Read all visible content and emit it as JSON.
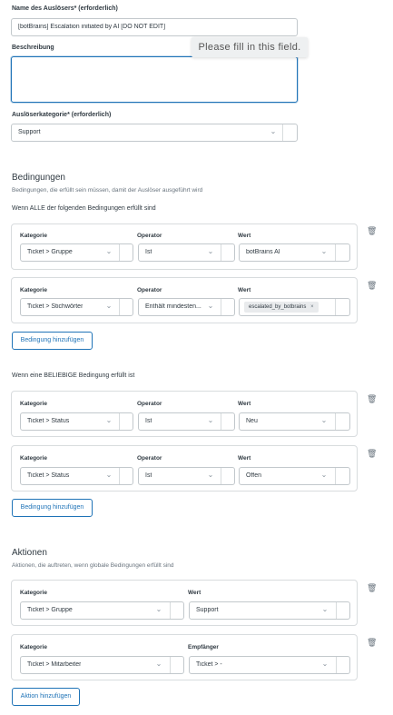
{
  "trigger_name": {
    "label": "Name des Auslösers* (erforderlich)",
    "value": "[botBrains] Escalation initiated by AI [DO NOT EDIT]"
  },
  "description": {
    "label": "Beschreibung",
    "value": "",
    "tooltip": "Please fill in this field."
  },
  "category": {
    "label": "Auslöserkategorie* (erforderlich)",
    "value": "Support"
  },
  "conditions": {
    "title": "Bedingungen",
    "subtitle": "Bedingungen, die erfüllt sein müssen, damit der Auslöser ausgeführt wird",
    "all_heading": "Wenn ALLE der folgenden Bedingungen erfüllt sind",
    "any_heading": "Wenn eine BELIEBIGE Bedingung erfüllt ist",
    "add_label": "Bedingung hinzufügen",
    "col_category": "Kategorie",
    "col_operator": "Operator",
    "col_value": "Wert",
    "all": [
      {
        "category": "Ticket > Gruppe",
        "operator": "Ist",
        "value": "botBrains AI"
      },
      {
        "category": "Ticket > Stichwörter",
        "operator": "Enthält mindesten...",
        "tag": "escalated_by_botbrains",
        "tag_remove": "×"
      }
    ],
    "any": [
      {
        "category": "Ticket > Status",
        "operator": "Ist",
        "value": "Neu"
      },
      {
        "category": "Ticket > Status",
        "operator": "Ist",
        "value": "Offen"
      }
    ]
  },
  "actions": {
    "title": "Aktionen",
    "subtitle": "Aktionen, die auftreten, wenn globale Bedingungen erfüllt sind",
    "add_label": "Aktion hinzufügen",
    "items": [
      {
        "category_label": "Kategorie",
        "category": "Ticket > Gruppe",
        "value_label": "Wert",
        "value": "Support"
      },
      {
        "category_label": "Kategorie",
        "category": "Ticket > Mitarbeiter",
        "value_label": "Empfänger",
        "value": "Ticket > -"
      }
    ]
  },
  "icons": {
    "chevron": "chevron-down-icon",
    "trash": "trash-icon"
  },
  "colors": {
    "accent": "#1f73b7",
    "border": "#c2c8cc",
    "text": "#2f3941",
    "muted": "#68737d"
  }
}
